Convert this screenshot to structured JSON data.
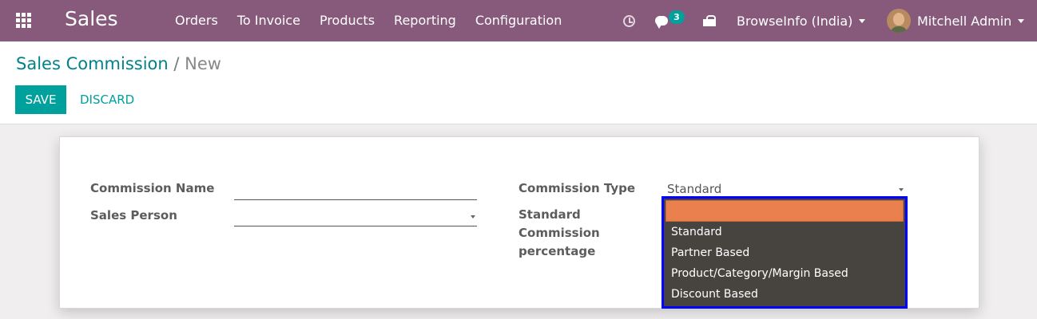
{
  "navbar": {
    "app_name": "Sales",
    "menu": [
      "Orders",
      "To Invoice",
      "Products",
      "Reporting",
      "Configuration"
    ],
    "messages_count": "3",
    "company": "BrowseInfo (India)",
    "user": "Mitchell Admin",
    "color": "#875a7b"
  },
  "breadcrumb": {
    "parent": "Sales Commission",
    "separator": "/",
    "current": "New"
  },
  "actions": {
    "save_label": "SAVE",
    "discard_label": "DISCARD"
  },
  "form": {
    "commission_name_label": "Commission Name",
    "commission_name_value": "",
    "sales_person_label": "Sales Person",
    "sales_person_value": "",
    "commission_type_label": "Commission Type",
    "commission_type_value": "Standard",
    "standard_pct_label_line1": "Standard",
    "standard_pct_label_line2": "Commission",
    "standard_pct_label_line3": "percentage"
  },
  "dropdown": {
    "options": [
      "",
      "Standard",
      "Partner Based",
      "Product/Category/Margin Based",
      "Discount Based"
    ],
    "highlight_color": "#e9804d"
  },
  "accent_color": "#00a09d"
}
